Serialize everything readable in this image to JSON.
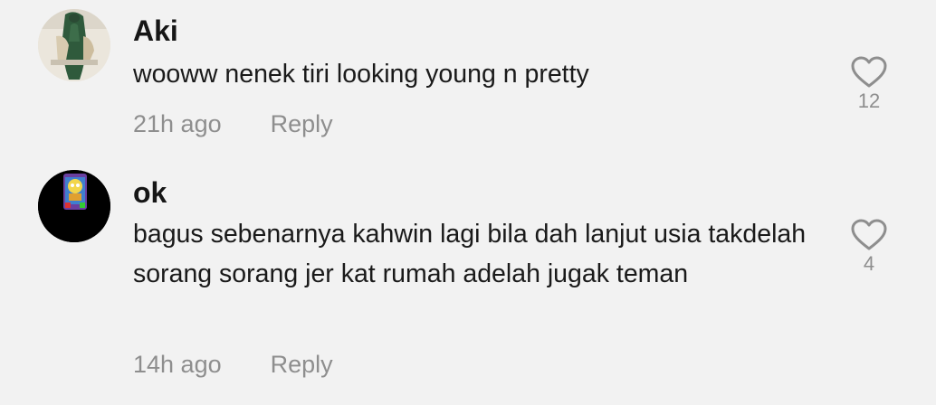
{
  "comments": [
    {
      "username": "Aki",
      "text": "wooww nenek tiri looking young n pretty",
      "time": "21h ago",
      "reply_label": "Reply",
      "like_count": "12",
      "avatar_icon": "profile-photo"
    },
    {
      "username": "ok",
      "text": "bagus sebenarnya kahwin lagi bila dah lanjut usia takdelah sorang sorang jer kat rumah adelah jugak teman",
      "time": "14h ago",
      "reply_label": "Reply",
      "like_count": "4",
      "avatar_icon": "cartoon-avatar"
    }
  ],
  "colors": {
    "background": "#f2f2f2",
    "primary_text": "#161616",
    "secondary_text": "#8e8e8e"
  }
}
